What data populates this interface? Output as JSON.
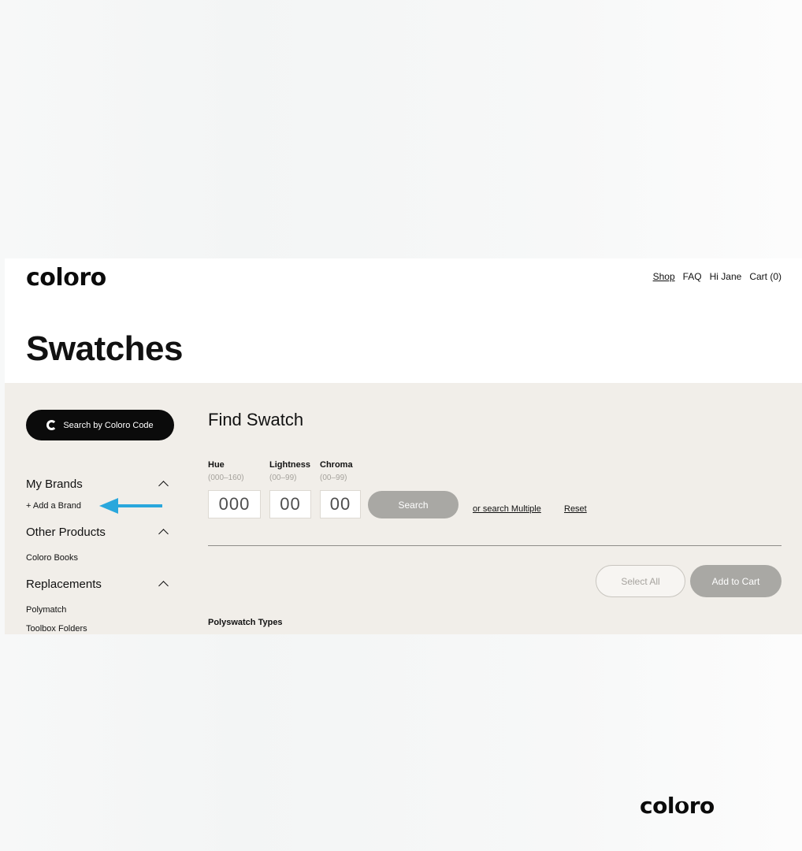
{
  "brand": {
    "logo_parts": [
      "col",
      "o",
      "r",
      "o"
    ]
  },
  "header": {
    "nav": [
      {
        "label": "Shop",
        "underlined": true
      },
      {
        "label": "FAQ"
      },
      {
        "label": "Hi Jane"
      },
      {
        "label": "Cart (0)"
      }
    ]
  },
  "page": {
    "title": "Swatches"
  },
  "sidebar": {
    "code_search_label": "Search by Coloro Code",
    "sections": [
      {
        "title": "My Brands",
        "items": [
          "+ Add a Brand"
        ]
      },
      {
        "title": "Other Products",
        "items": [
          "Coloro Books"
        ]
      },
      {
        "title": "Replacements",
        "items": [
          "Polymatch",
          "Toolbox Folders"
        ]
      }
    ],
    "arrow_color": "#2aa7dc"
  },
  "find": {
    "title": "Find Swatch",
    "fields": [
      {
        "label": "Hue",
        "range": "(000–160)",
        "value": "000"
      },
      {
        "label": "Lightness",
        "range": "(00–99)",
        "value": "00"
      },
      {
        "label": "Chroma",
        "range": "(00–99)",
        "value": "00"
      }
    ],
    "search_label": "Search",
    "multiple_link": "or search Multiple",
    "reset_link": "Reset"
  },
  "actions": {
    "select_all": "Select All",
    "add_to_cart": "Add to Cart"
  },
  "results": {
    "section_title": "Polyswatch Types"
  },
  "colors": {
    "panel_bg": "#f1eee9",
    "dark_button": "#0b0b0b",
    "disabled_button": "#a9a8a4"
  }
}
